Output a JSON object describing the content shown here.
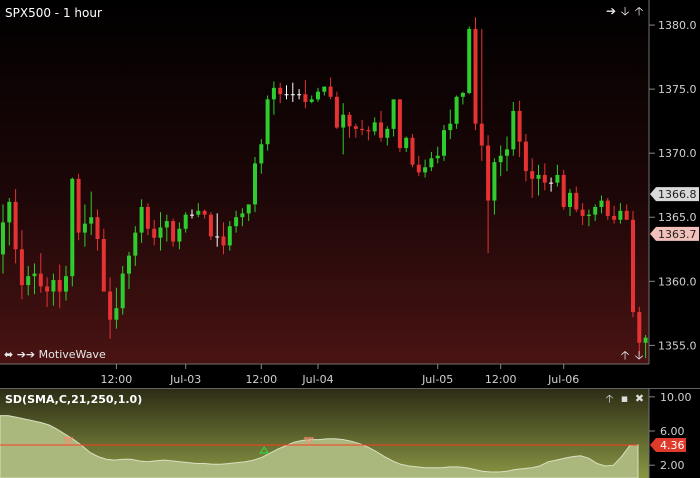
{
  "price_panel": {
    "title": "SPX500 - 1 hour",
    "watermark": "MotiveWave",
    "current_price_label": "1366.8",
    "last_price_label": "1363.7",
    "colors": {
      "up": "#2ecc2e",
      "down": "#e53232",
      "doji": "#ffffff",
      "bg_top": "#000000",
      "bg_bottom": "#4a1313"
    },
    "nav_icons": [
      "arrow-right-icon",
      "arrow-down-icon",
      "arrow-up-icon"
    ],
    "bottom_icons": [
      "arrow-up-icon",
      "arrow-down-icon"
    ]
  },
  "indicator_panel": {
    "title": "SD(SMA,C,21,250,1.0)",
    "current_value_label": "4.36",
    "colors": {
      "fill": "#aab87e",
      "line": "#ff3b1e",
      "bg_top": "#2b2b14",
      "bg_bottom": "#8a9644"
    },
    "header_icons": [
      "arrow-up-icon",
      "window-icon",
      "close-icon"
    ]
  },
  "chart_data": [
    {
      "type": "candlestick",
      "title": "SPX500 - 1 hour",
      "y_axis_ticks": [
        "1380.0",
        "1375.0",
        "1370.0",
        "1365.0",
        "1360.0",
        "1355.0"
      ],
      "ylim": [
        1353.7,
        1381.8
      ],
      "x_axis_labels": [
        "12:00",
        "Jul-03",
        "12:00",
        "Jul-04",
        "Jul-05",
        "12:00",
        "Jul-06"
      ],
      "series": [
        {
          "name": "SPX500",
          "ohlc": [
            [
              1362.1,
              1366.0,
              1360.6,
              1364.6
            ],
            [
              1364.6,
              1366.5,
              1362.8,
              1366.2
            ],
            [
              1366.2,
              1367.2,
              1361.4,
              1362.5
            ],
            [
              1362.5,
              1364.0,
              1358.6,
              1359.7
            ],
            [
              1359.7,
              1361.2,
              1358.9,
              1360.4
            ],
            [
              1360.4,
              1361.4,
              1359.0,
              1360.6
            ],
            [
              1360.6,
              1362.2,
              1359.1,
              1359.6
            ],
            [
              1359.6,
              1360.3,
              1358.0,
              1359.2
            ],
            [
              1359.2,
              1360.6,
              1358.1,
              1360.1
            ],
            [
              1360.1,
              1361.3,
              1357.9,
              1359.2
            ],
            [
              1359.2,
              1361.2,
              1358.5,
              1360.4
            ],
            [
              1360.4,
              1368.1,
              1359.6,
              1368.0
            ],
            [
              1368.0,
              1368.4,
              1363.2,
              1363.8
            ],
            [
              1363.8,
              1366.0,
              1362.7,
              1364.5
            ],
            [
              1364.5,
              1367.0,
              1363.6,
              1365.0
            ],
            [
              1365.0,
              1365.6,
              1362.4,
              1363.3
            ],
            [
              1363.3,
              1364.1,
              1359.2,
              1359.2
            ],
            [
              1359.2,
              1360.3,
              1355.5,
              1357.0
            ],
            [
              1357.0,
              1359.5,
              1356.3,
              1357.9
            ],
            [
              1357.9,
              1361.2,
              1357.4,
              1360.6
            ],
            [
              1360.6,
              1362.3,
              1359.4,
              1362.0
            ],
            [
              1362.0,
              1364.3,
              1361.2,
              1363.8
            ],
            [
              1363.8,
              1366.4,
              1363.0,
              1365.8
            ],
            [
              1365.8,
              1366.1,
              1363.6,
              1364.1
            ],
            [
              1364.1,
              1364.8,
              1362.8,
              1363.4
            ],
            [
              1363.4,
              1365.4,
              1362.4,
              1364.2
            ],
            [
              1364.2,
              1365.2,
              1363.1,
              1364.7
            ],
            [
              1364.7,
              1364.9,
              1362.7,
              1363.1
            ],
            [
              1363.1,
              1364.6,
              1362.5,
              1364.1
            ],
            [
              1364.1,
              1365.4,
              1363.8,
              1365.2
            ],
            [
              1365.2,
              1365.6,
              1364.9,
              1365.2
            ],
            [
              1365.2,
              1366.1,
              1365.0,
              1365.5
            ],
            [
              1365.5,
              1365.6,
              1364.9,
              1365.2
            ],
            [
              1365.2,
              1365.4,
              1363.2,
              1363.5
            ],
            [
              1363.5,
              1365.3,
              1362.7,
              1363.5
            ],
            [
              1363.5,
              1364.6,
              1362.1,
              1362.8
            ],
            [
              1362.8,
              1364.7,
              1362.4,
              1364.3
            ],
            [
              1364.3,
              1365.5,
              1363.8,
              1365.0
            ],
            [
              1365.0,
              1365.7,
              1364.3,
              1365.3
            ],
            [
              1365.3,
              1366.0,
              1364.7,
              1366.0
            ],
            [
              1366.0,
              1369.7,
              1365.4,
              1369.2
            ],
            [
              1369.2,
              1371.1,
              1368.4,
              1370.7
            ],
            [
              1370.7,
              1374.5,
              1370.2,
              1374.2
            ],
            [
              1374.2,
              1375.6,
              1373.0,
              1375.1
            ],
            [
              1375.1,
              1375.5,
              1373.9,
              1374.6
            ],
            [
              1374.6,
              1375.3,
              1374.2,
              1374.6
            ],
            [
              1374.6,
              1375.5,
              1374.0,
              1374.6
            ],
            [
              1374.6,
              1375.0,
              1374.2,
              1374.6
            ],
            [
              1374.6,
              1375.7,
              1373.5,
              1374.0
            ],
            [
              1374.0,
              1374.5,
              1373.9,
              1374.2
            ],
            [
              1374.2,
              1375.1,
              1374.0,
              1374.8
            ],
            [
              1374.8,
              1375.2,
              1374.5,
              1375.2
            ],
            [
              1375.2,
              1375.9,
              1374.2,
              1374.4
            ],
            [
              1374.4,
              1374.8,
              1371.9,
              1372.0
            ],
            [
              1372.0,
              1373.9,
              1369.9,
              1373.0
            ],
            [
              1373.0,
              1373.2,
              1371.2,
              1372.1
            ],
            [
              1372.1,
              1372.3,
              1371.2,
              1371.9
            ],
            [
              1371.9,
              1372.6,
              1371.4,
              1371.8
            ],
            [
              1371.8,
              1372.1,
              1371.0,
              1371.7
            ],
            [
              1371.7,
              1372.8,
              1371.4,
              1372.4
            ],
            [
              1372.4,
              1373.3,
              1370.9,
              1371.2
            ],
            [
              1371.2,
              1372.1,
              1370.6,
              1371.9
            ],
            [
              1371.9,
              1374.2,
              1371.3,
              1374.2
            ],
            [
              1374.2,
              1374.2,
              1370.1,
              1370.4
            ],
            [
              1370.4,
              1371.3,
              1370.1,
              1371.2
            ],
            [
              1371.2,
              1371.5,
              1368.9,
              1369.1
            ],
            [
              1369.1,
              1369.8,
              1368.2,
              1368.5
            ],
            [
              1368.5,
              1369.5,
              1368.1,
              1368.9
            ],
            [
              1368.9,
              1370.1,
              1368.6,
              1369.6
            ],
            [
              1369.6,
              1370.5,
              1369.2,
              1369.8
            ],
            [
              1369.8,
              1372.2,
              1369.4,
              1371.8
            ],
            [
              1371.8,
              1373.4,
              1371.1,
              1372.3
            ],
            [
              1372.3,
              1374.5,
              1371.9,
              1374.4
            ],
            [
              1374.4,
              1374.8,
              1373.8,
              1374.7
            ],
            [
              1374.7,
              1379.9,
              1374.6,
              1379.7
            ],
            [
              1379.7,
              1380.6,
              1371.8,
              1372.3
            ],
            [
              1372.3,
              1379.7,
              1369.4,
              1370.6
            ],
            [
              1370.6,
              1371.4,
              1362.2,
              1366.3
            ],
            [
              1366.3,
              1369.6,
              1365.2,
              1369.3
            ],
            [
              1369.3,
              1370.6,
              1368.2,
              1369.8
            ],
            [
              1369.8,
              1371.3,
              1368.6,
              1370.3
            ],
            [
              1370.3,
              1374.0,
              1369.8,
              1373.3
            ],
            [
              1373.3,
              1374.1,
              1369.7,
              1370.9
            ],
            [
              1370.9,
              1371.5,
              1367.8,
              1368.6
            ],
            [
              1368.6,
              1369.6,
              1366.5,
              1368.0
            ],
            [
              1368.0,
              1369.1,
              1366.7,
              1368.3
            ],
            [
              1368.3,
              1369.2,
              1367.1,
              1367.7
            ],
            [
              1367.7,
              1368.1,
              1367.0,
              1367.7
            ],
            [
              1367.7,
              1369.1,
              1367.4,
              1368.3
            ],
            [
              1368.3,
              1368.7,
              1365.6,
              1365.8
            ],
            [
              1365.8,
              1367.2,
              1365.1,
              1366.9
            ],
            [
              1366.9,
              1367.4,
              1365.4,
              1365.6
            ],
            [
              1365.6,
              1366.1,
              1364.4,
              1365.1
            ],
            [
              1365.1,
              1365.6,
              1364.3,
              1365.2
            ],
            [
              1365.2,
              1366.0,
              1364.7,
              1365.8
            ],
            [
              1365.8,
              1366.7,
              1365.3,
              1366.3
            ],
            [
              1366.3,
              1366.5,
              1364.8,
              1365.1
            ],
            [
              1365.1,
              1365.9,
              1364.5,
              1364.8
            ],
            [
              1364.8,
              1366.1,
              1364.5,
              1365.5
            ],
            [
              1365.5,
              1366.0,
              1364.8,
              1364.8
            ],
            [
              1364.8,
              1365.5,
              1357.2,
              1357.6
            ],
            [
              1357.6,
              1358.0,
              1354.2,
              1355.2
            ],
            [
              1355.2,
              1355.8,
              1354.0,
              1355.6
            ]
          ]
        }
      ]
    },
    {
      "type": "area",
      "title": "SD(SMA,C,21,250,1.0)",
      "y_axis_ticks": [
        "10.00",
        "6.00",
        "2.00"
      ],
      "ylim": [
        0.5,
        10.8
      ],
      "reference_line": 4.36,
      "markers": [
        {
          "type": "sell",
          "position": 0.107
        },
        {
          "type": "buy",
          "position": 0.414
        },
        {
          "type": "sell",
          "position": 0.484
        }
      ],
      "series": [
        {
          "name": "SD",
          "values": [
            7.8,
            7.8,
            7.6,
            7.4,
            7.2,
            7.0,
            6.7,
            6.2,
            5.6,
            5.0,
            4.3,
            3.5,
            3.0,
            2.7,
            2.6,
            2.7,
            2.7,
            2.5,
            2.4,
            2.5,
            2.6,
            2.5,
            2.4,
            2.3,
            2.2,
            2.2,
            2.1,
            2.1,
            2.2,
            2.3,
            2.4,
            2.6,
            2.9,
            3.4,
            3.9,
            4.3,
            4.7,
            4.9,
            5.0,
            5.0,
            5.1,
            5.1,
            5.0,
            4.8,
            4.5,
            4.1,
            3.6,
            3.0,
            2.5,
            2.1,
            1.9,
            1.8,
            1.7,
            1.7,
            1.7,
            1.8,
            1.8,
            1.7,
            1.5,
            1.3,
            1.2,
            1.2,
            1.3,
            1.5,
            1.6,
            1.7,
            1.9,
            2.4,
            2.6,
            2.8,
            3.0,
            3.1,
            2.8,
            2.2,
            1.9,
            2.0,
            3.0,
            4.3,
            4.4
          ]
        }
      ]
    }
  ]
}
